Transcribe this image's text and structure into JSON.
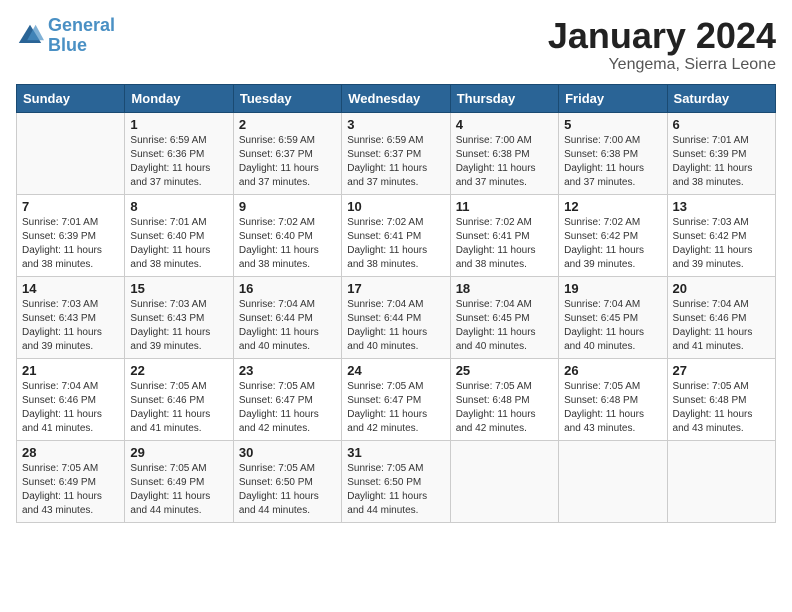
{
  "logo": {
    "line1": "General",
    "line2": "Blue"
  },
  "title": "January 2024",
  "subtitle": "Yengema, Sierra Leone",
  "days_of_week": [
    "Sunday",
    "Monday",
    "Tuesday",
    "Wednesday",
    "Thursday",
    "Friday",
    "Saturday"
  ],
  "weeks": [
    [
      {
        "num": "",
        "info": ""
      },
      {
        "num": "1",
        "info": "Sunrise: 6:59 AM\nSunset: 6:36 PM\nDaylight: 11 hours\nand 37 minutes."
      },
      {
        "num": "2",
        "info": "Sunrise: 6:59 AM\nSunset: 6:37 PM\nDaylight: 11 hours\nand 37 minutes."
      },
      {
        "num": "3",
        "info": "Sunrise: 6:59 AM\nSunset: 6:37 PM\nDaylight: 11 hours\nand 37 minutes."
      },
      {
        "num": "4",
        "info": "Sunrise: 7:00 AM\nSunset: 6:38 PM\nDaylight: 11 hours\nand 37 minutes."
      },
      {
        "num": "5",
        "info": "Sunrise: 7:00 AM\nSunset: 6:38 PM\nDaylight: 11 hours\nand 37 minutes."
      },
      {
        "num": "6",
        "info": "Sunrise: 7:01 AM\nSunset: 6:39 PM\nDaylight: 11 hours\nand 38 minutes."
      }
    ],
    [
      {
        "num": "7",
        "info": "Sunrise: 7:01 AM\nSunset: 6:39 PM\nDaylight: 11 hours\nand 38 minutes."
      },
      {
        "num": "8",
        "info": "Sunrise: 7:01 AM\nSunset: 6:40 PM\nDaylight: 11 hours\nand 38 minutes."
      },
      {
        "num": "9",
        "info": "Sunrise: 7:02 AM\nSunset: 6:40 PM\nDaylight: 11 hours\nand 38 minutes."
      },
      {
        "num": "10",
        "info": "Sunrise: 7:02 AM\nSunset: 6:41 PM\nDaylight: 11 hours\nand 38 minutes."
      },
      {
        "num": "11",
        "info": "Sunrise: 7:02 AM\nSunset: 6:41 PM\nDaylight: 11 hours\nand 38 minutes."
      },
      {
        "num": "12",
        "info": "Sunrise: 7:02 AM\nSunset: 6:42 PM\nDaylight: 11 hours\nand 39 minutes."
      },
      {
        "num": "13",
        "info": "Sunrise: 7:03 AM\nSunset: 6:42 PM\nDaylight: 11 hours\nand 39 minutes."
      }
    ],
    [
      {
        "num": "14",
        "info": "Sunrise: 7:03 AM\nSunset: 6:43 PM\nDaylight: 11 hours\nand 39 minutes."
      },
      {
        "num": "15",
        "info": "Sunrise: 7:03 AM\nSunset: 6:43 PM\nDaylight: 11 hours\nand 39 minutes."
      },
      {
        "num": "16",
        "info": "Sunrise: 7:04 AM\nSunset: 6:44 PM\nDaylight: 11 hours\nand 40 minutes."
      },
      {
        "num": "17",
        "info": "Sunrise: 7:04 AM\nSunset: 6:44 PM\nDaylight: 11 hours\nand 40 minutes."
      },
      {
        "num": "18",
        "info": "Sunrise: 7:04 AM\nSunset: 6:45 PM\nDaylight: 11 hours\nand 40 minutes."
      },
      {
        "num": "19",
        "info": "Sunrise: 7:04 AM\nSunset: 6:45 PM\nDaylight: 11 hours\nand 40 minutes."
      },
      {
        "num": "20",
        "info": "Sunrise: 7:04 AM\nSunset: 6:46 PM\nDaylight: 11 hours\nand 41 minutes."
      }
    ],
    [
      {
        "num": "21",
        "info": "Sunrise: 7:04 AM\nSunset: 6:46 PM\nDaylight: 11 hours\nand 41 minutes."
      },
      {
        "num": "22",
        "info": "Sunrise: 7:05 AM\nSunset: 6:46 PM\nDaylight: 11 hours\nand 41 minutes."
      },
      {
        "num": "23",
        "info": "Sunrise: 7:05 AM\nSunset: 6:47 PM\nDaylight: 11 hours\nand 42 minutes."
      },
      {
        "num": "24",
        "info": "Sunrise: 7:05 AM\nSunset: 6:47 PM\nDaylight: 11 hours\nand 42 minutes."
      },
      {
        "num": "25",
        "info": "Sunrise: 7:05 AM\nSunset: 6:48 PM\nDaylight: 11 hours\nand 42 minutes."
      },
      {
        "num": "26",
        "info": "Sunrise: 7:05 AM\nSunset: 6:48 PM\nDaylight: 11 hours\nand 43 minutes."
      },
      {
        "num": "27",
        "info": "Sunrise: 7:05 AM\nSunset: 6:48 PM\nDaylight: 11 hours\nand 43 minutes."
      }
    ],
    [
      {
        "num": "28",
        "info": "Sunrise: 7:05 AM\nSunset: 6:49 PM\nDaylight: 11 hours\nand 43 minutes."
      },
      {
        "num": "29",
        "info": "Sunrise: 7:05 AM\nSunset: 6:49 PM\nDaylight: 11 hours\nand 44 minutes."
      },
      {
        "num": "30",
        "info": "Sunrise: 7:05 AM\nSunset: 6:50 PM\nDaylight: 11 hours\nand 44 minutes."
      },
      {
        "num": "31",
        "info": "Sunrise: 7:05 AM\nSunset: 6:50 PM\nDaylight: 11 hours\nand 44 minutes."
      },
      {
        "num": "",
        "info": ""
      },
      {
        "num": "",
        "info": ""
      },
      {
        "num": "",
        "info": ""
      }
    ]
  ]
}
